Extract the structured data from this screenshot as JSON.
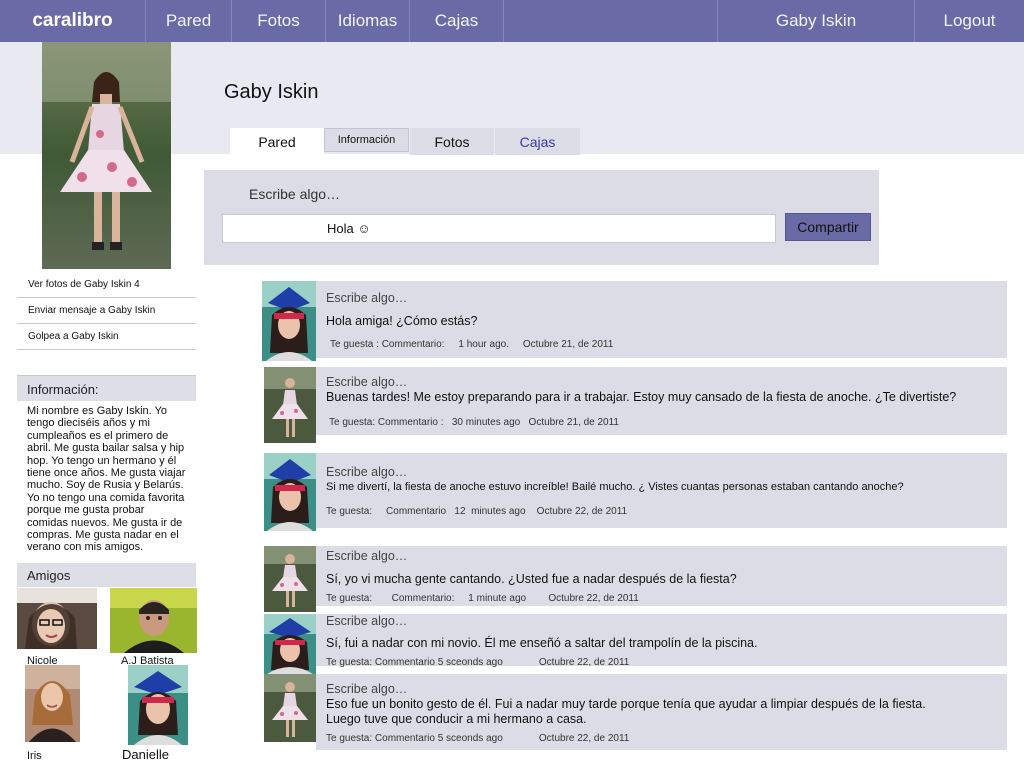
{
  "nav": {
    "brand": "caralibro",
    "items": [
      "Pared",
      "Fotos",
      "Idiomas",
      "Cajas"
    ],
    "user": "Gaby Iskin",
    "logout": "Logout"
  },
  "profile": {
    "name": "Gaby Iskin",
    "tabs": [
      "Pared",
      "Información",
      "Fotos",
      "Cajas"
    ]
  },
  "composer": {
    "placeholder": "Escribe algo…",
    "value": "Hola ☺",
    "button": "Compartir"
  },
  "actions": [
    "Ver fotos de Gaby Iskin 4",
    "Enviar mensaje a Gaby Iskin",
    "Golpea a Gaby Iskin"
  ],
  "info": {
    "title": "Información:",
    "text": "Mi nombre es Gaby Iskin. Yo tengo dieciséis años y mi cumpleaños es el primero de abril. Me gusta bailar salsa y hip hop. Yo tengo un hermano y él tiene once años. Me gusta viajar mucho. Soy de Rusia y Belarús. Yo no tengo una comida favorita porque me gusta probar comidas nuevos. Me gusta ir de compras. Me gusta nadar en el verano con mis amigos."
  },
  "friends": {
    "title": "Amigos",
    "names": [
      "Nicole",
      "A.J Batista",
      "Iris",
      "Danielle"
    ]
  },
  "posts": [
    {
      "placeholder": "Escribe algo…",
      "text": "Hola amiga! ¿Cómo estás?",
      "meta": "Te guesta : Commentario:     1 hour ago.     Octubre 21, de 2011"
    },
    {
      "placeholder": "Escribe algo…",
      "text": "Buenas tardes! Me estoy preparando para ir a trabajar. Estoy muy cansado de la fiesta de anoche. ¿Te divertiste?",
      "meta": "Te guesta: Commentario :   30 minutes ago   Octubre 21, de 2011"
    },
    {
      "placeholder": "Escribe algo…",
      "text": "Si me divertí, la fiesta de anoche estuvo increíble! Bailé mucho. ¿ Vistes cuantas personas estaban cantando anoche?",
      "meta": "Te guesta:     Commentario   12  minutes ago    Octubre 22, de 2011"
    },
    {
      "placeholder": "Escribe algo…",
      "text": "Sí, yo vi mucha gente cantando. ¿Usted fue a nadar después de la fiesta?",
      "meta": "Te guesta:       Commentario:     1 minute ago        Octubre 22, de 2011"
    },
    {
      "placeholder": "Escribe algo…",
      "text": "Sí, fui a nadar con mi novio. Él me enseñó a saltar del trampolín de la piscina.",
      "meta": "Te guesta: Commentario 5 sceonds ago             Octubre 22, de 2011"
    },
    {
      "placeholder": "Escribe algo…",
      "text": "Eso fue un bonito gesto de él. Fui a nadar muy tarde porque tenía que ayudar a limpiar después de la fiesta.\n Luego tuve que conducir a mi hermano a casa.",
      "meta": "Te guesta: Commentario 5 sceonds ago             Octubre 22, de 2011"
    }
  ],
  "colors": {
    "nav": "#6a6aa6",
    "band": "#e9e9f1",
    "panel": "#dcdce6",
    "link_tab": "#3a3aa8"
  }
}
